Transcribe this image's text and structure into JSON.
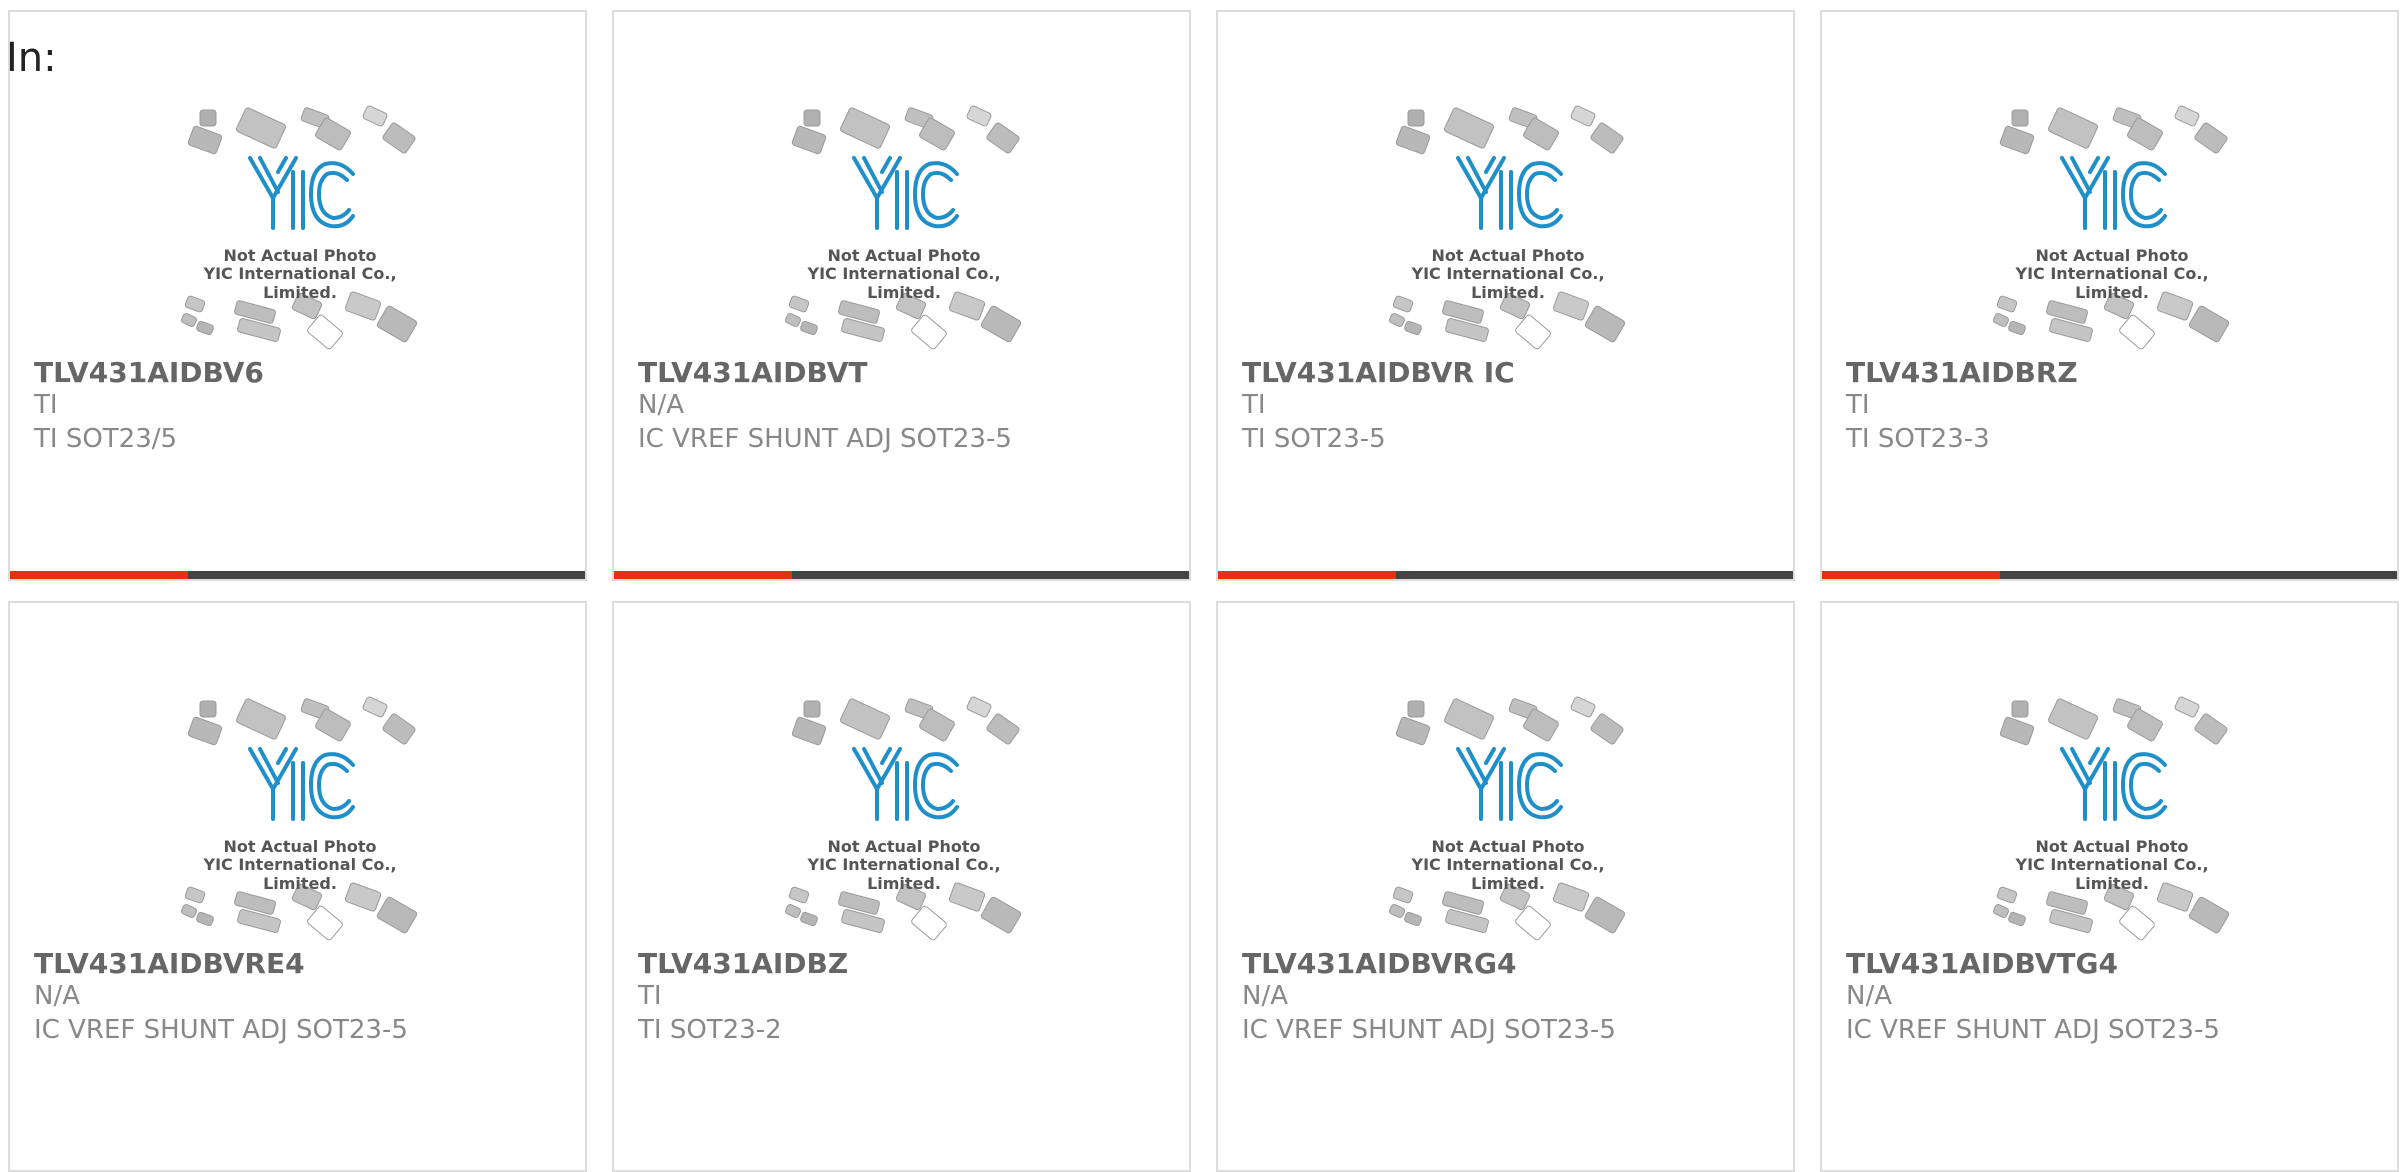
{
  "page": {
    "label": "In:"
  },
  "photo": {
    "logo_icon": "yic-logo-icon",
    "caption_line1": "Not Actual Photo",
    "caption_line2": "YIC International Co., Limited."
  },
  "colors": {
    "bar_accent": "#e3320c",
    "bar_base": "#444444",
    "logo_blue": "#1f8fc9"
  },
  "bar_fill_fraction": 0.31,
  "products": [
    {
      "part_number": "TLV431AIDBV6",
      "manufacturer": "TI",
      "description": "TI SOT23/5"
    },
    {
      "part_number": "TLV431AIDBVT",
      "manufacturer": "N/A",
      "description": "IC VREF SHUNT ADJ SOT23-5"
    },
    {
      "part_number": "TLV431AIDBVR IC",
      "manufacturer": "TI",
      "description": "TI SOT23-5"
    },
    {
      "part_number": "TLV431AIDBRZ",
      "manufacturer": "TI",
      "description": "TI SOT23-3"
    },
    {
      "part_number": "TLV431AIDBVRE4",
      "manufacturer": "N/A",
      "description": "IC VREF SHUNT ADJ SOT23-5"
    },
    {
      "part_number": "TLV431AIDBZ",
      "manufacturer": "TI",
      "description": "TI SOT23-2"
    },
    {
      "part_number": "TLV431AIDBVRG4",
      "manufacturer": "N/A",
      "description": "IC VREF SHUNT ADJ SOT23-5"
    },
    {
      "part_number": "TLV431AIDBVTG4",
      "manufacturer": "N/A",
      "description": "IC VREF SHUNT ADJ SOT23-5"
    }
  ]
}
